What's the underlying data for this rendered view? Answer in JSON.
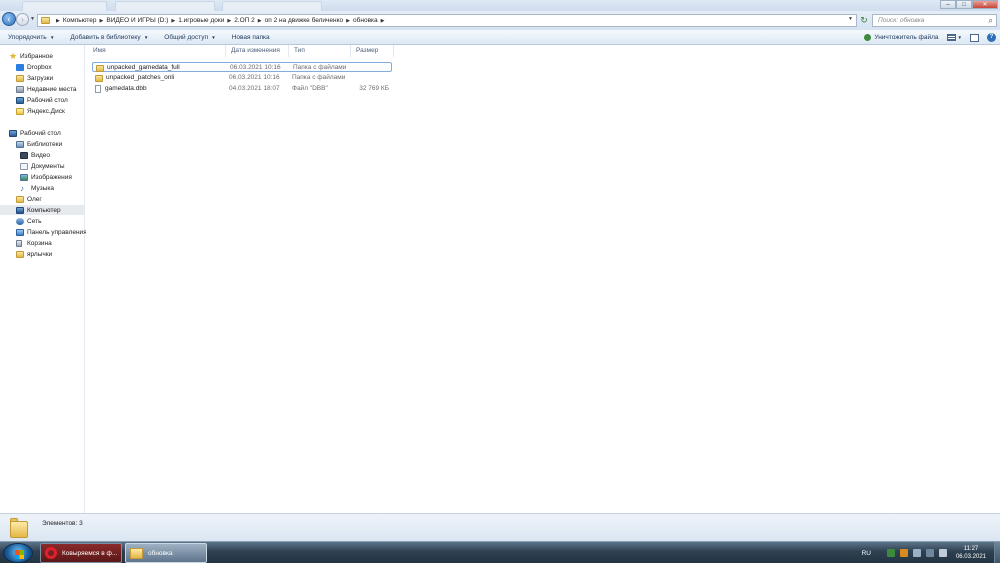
{
  "window": {
    "minimize_glyph": "–",
    "maximize_glyph": "□",
    "close_glyph": "✕"
  },
  "address": {
    "breadcrumbs": [
      "Компьютер",
      "ВИДЕО И ИГРЫ (D:)",
      "1.игровые доки",
      "2.ОП 2",
      "оп 2 на движке беличенко",
      "обновка"
    ],
    "search_placeholder": "Поиск: обновка"
  },
  "toolbar": {
    "organize": "Упорядочить",
    "add_to_library": "Добавить в библиотеку",
    "share": "Общий доступ",
    "new_folder": "Новая папка",
    "shredder": "Уничтожитель файла"
  },
  "nav": {
    "favorites": "Избранное",
    "dropbox": "Dropbox",
    "downloads": "Загрузки",
    "recent": "Недавние места",
    "desktop": "Рабочий стол",
    "yandex_disk": "Яндекс.Диск",
    "desktop_root": "Рабочий стол",
    "libraries": "Библиотеки",
    "video": "Видео",
    "documents": "Документы",
    "images": "Изображения",
    "music": "Музыка",
    "user": "Олег",
    "computer": "Компьютер",
    "network": "Сеть",
    "control_panel": "Панель управления",
    "recycle_bin": "Корзина",
    "shortcuts": "ярлычки"
  },
  "columns": {
    "name": "Имя",
    "date": "Дата изменения",
    "type": "Тип",
    "size": "Размер"
  },
  "files": [
    {
      "name": "unpacked_gamedata_full",
      "date": "06.03.2021 10:16",
      "type": "Папка с файлами",
      "size": ""
    },
    {
      "name": "unpacked_patches_onli",
      "date": "06.03.2021 10:16",
      "type": "Папка с файлами",
      "size": ""
    },
    {
      "name": "gamedata.dbb",
      "date": "04.03.2021 18:07",
      "type": "Файл \"DBB\"",
      "size": "32 769 КБ"
    }
  ],
  "details": {
    "count_text": "Элементов: 3"
  },
  "taskbar": {
    "opera_label": "Ковыряемся в ф...",
    "explorer_label": "обновка",
    "lang": "RU",
    "time": "11:27",
    "date": "06.03.2021"
  }
}
